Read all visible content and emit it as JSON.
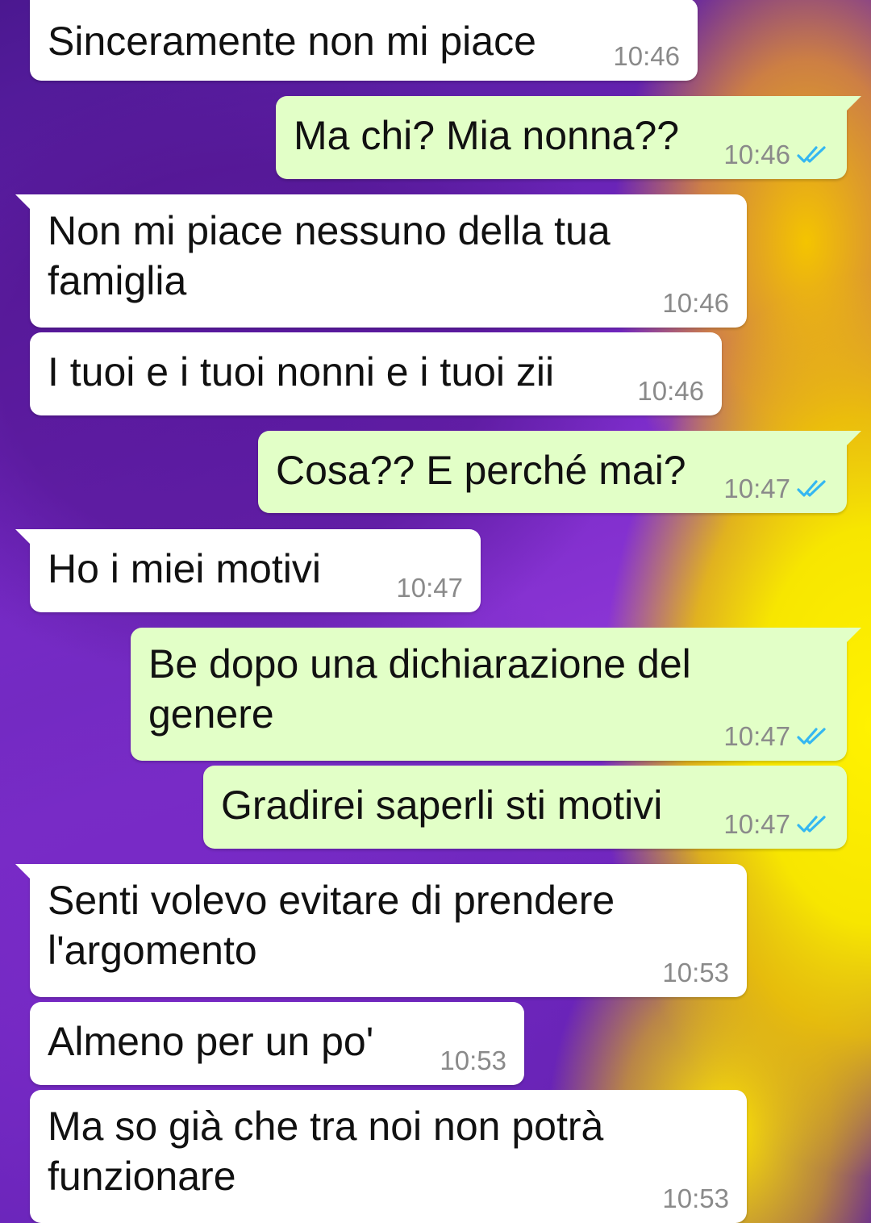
{
  "colors": {
    "incoming_bubble": "#ffffff",
    "outgoing_bubble": "#e2ffc7",
    "timestamp": "#8a8a8a",
    "read_ticks": "#34b7f1",
    "background_primary": "#7428c4",
    "background_secondary": "#fff200"
  },
  "messages": [
    {
      "direction": "incoming",
      "text": "Sinceramente non mi piace",
      "time": "10:46"
    },
    {
      "direction": "outgoing",
      "text": "Ma chi? Mia nonna??",
      "time": "10:46",
      "status_icon": "double-check-read-icon"
    },
    {
      "direction": "incoming",
      "text": "Non mi piace nessuno della tua famiglia",
      "time": "10:46"
    },
    {
      "direction": "incoming",
      "text": "I tuoi e i tuoi nonni e i tuoi zii",
      "time": "10:46"
    },
    {
      "direction": "outgoing",
      "text": "Cosa?? E perché mai?",
      "time": "10:47",
      "status_icon": "double-check-read-icon"
    },
    {
      "direction": "incoming",
      "text": "Ho i miei motivi",
      "time": "10:47"
    },
    {
      "direction": "outgoing",
      "text": "Be dopo una dichiarazione del genere",
      "time": "10:47",
      "status_icon": "double-check-read-icon"
    },
    {
      "direction": "outgoing",
      "text": "Gradirei saperli sti motivi",
      "time": "10:47",
      "status_icon": "double-check-read-icon"
    },
    {
      "direction": "incoming",
      "text": "Senti volevo evitare di prendere l'argomento",
      "time": "10:53"
    },
    {
      "direction": "incoming",
      "text": "Almeno per un po'",
      "time": "10:53"
    },
    {
      "direction": "incoming",
      "text": "Ma so già che tra noi non potrà funzionare",
      "time": "10:53"
    }
  ]
}
